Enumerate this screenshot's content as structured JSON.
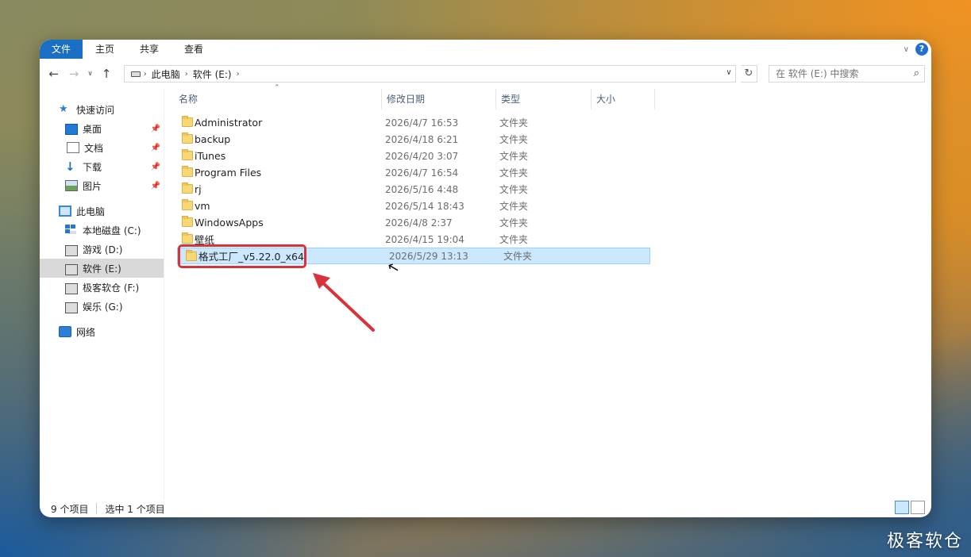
{
  "ribbon": {
    "tabs": [
      "文件",
      "主页",
      "共享",
      "查看"
    ],
    "help": "?"
  },
  "address": {
    "crumbs": [
      "此电脑",
      "软件 (E:)"
    ]
  },
  "search": {
    "placeholder": "在 软件 (E:) 中搜索"
  },
  "nav": {
    "quick_access": "快速访问",
    "quick_items": [
      "桌面",
      "文档",
      "下载",
      "图片"
    ],
    "this_pc": "此电脑",
    "drives": [
      "本地磁盘 (C:)",
      "游戏 (D:)",
      "软件 (E:)",
      "极客软仓 (F:)",
      "娱乐 (G:)"
    ],
    "network": "网络"
  },
  "columns": [
    "名称",
    "修改日期",
    "类型",
    "大小"
  ],
  "files": [
    {
      "name": "Administrator",
      "date": "2026/4/7 16:53",
      "type": "文件夹"
    },
    {
      "name": "backup",
      "date": "2026/4/18 6:21",
      "type": "文件夹"
    },
    {
      "name": "iTunes",
      "date": "2026/4/20 3:07",
      "type": "文件夹"
    },
    {
      "name": "Program Files",
      "date": "2026/4/7 16:54",
      "type": "文件夹"
    },
    {
      "name": "rj",
      "date": "2026/5/16 4:48",
      "type": "文件夹"
    },
    {
      "name": "vm",
      "date": "2026/5/14 18:43",
      "type": "文件夹"
    },
    {
      "name": "WindowsApps",
      "date": "2026/4/8 2:37",
      "type": "文件夹"
    },
    {
      "name": "壁纸",
      "date": "2026/4/15 19:04",
      "type": "文件夹"
    },
    {
      "name": "格式工厂_v5.22.0_x64",
      "date": "2026/5/29 13:13",
      "type": "文件夹"
    }
  ],
  "selected_index": 8,
  "status": {
    "count": "9 个项目",
    "selection": "选中 1 个项目"
  },
  "watermark": "极客软仓",
  "colors": {
    "accent": "#1a6fc4",
    "selection": "#cce8ff",
    "annotation": "#d8333a"
  }
}
